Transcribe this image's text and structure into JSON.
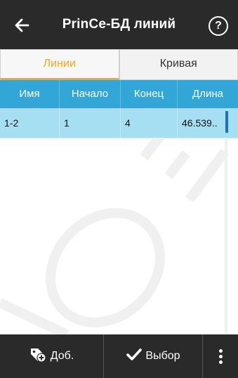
{
  "header": {
    "title": "PrinCe-БД линий",
    "back_icon": "arrow-left-icon",
    "help_label": "?"
  },
  "tabs": [
    {
      "label": "Линии",
      "active": true
    },
    {
      "label": "Кривая",
      "active": false
    }
  ],
  "table": {
    "columns": [
      "Имя",
      "Начало",
      "Конец",
      "Длина"
    ],
    "rows": [
      {
        "name": "1-2",
        "start": "1",
        "end": "4",
        "length": "46.539.."
      }
    ]
  },
  "toolbar": {
    "add_label": "Доб.",
    "add_icon": "tag-add-icon",
    "select_label": "Выбор",
    "select_icon": "checkmark-icon",
    "more_icon": "more-vertical-icon"
  },
  "colors": {
    "topbar": "#2a2a2a",
    "accent": "#f5a623",
    "table_header": "#33a6d8",
    "selected_row": "#a6dff2",
    "scroll_thumb": "#1e72b8"
  }
}
